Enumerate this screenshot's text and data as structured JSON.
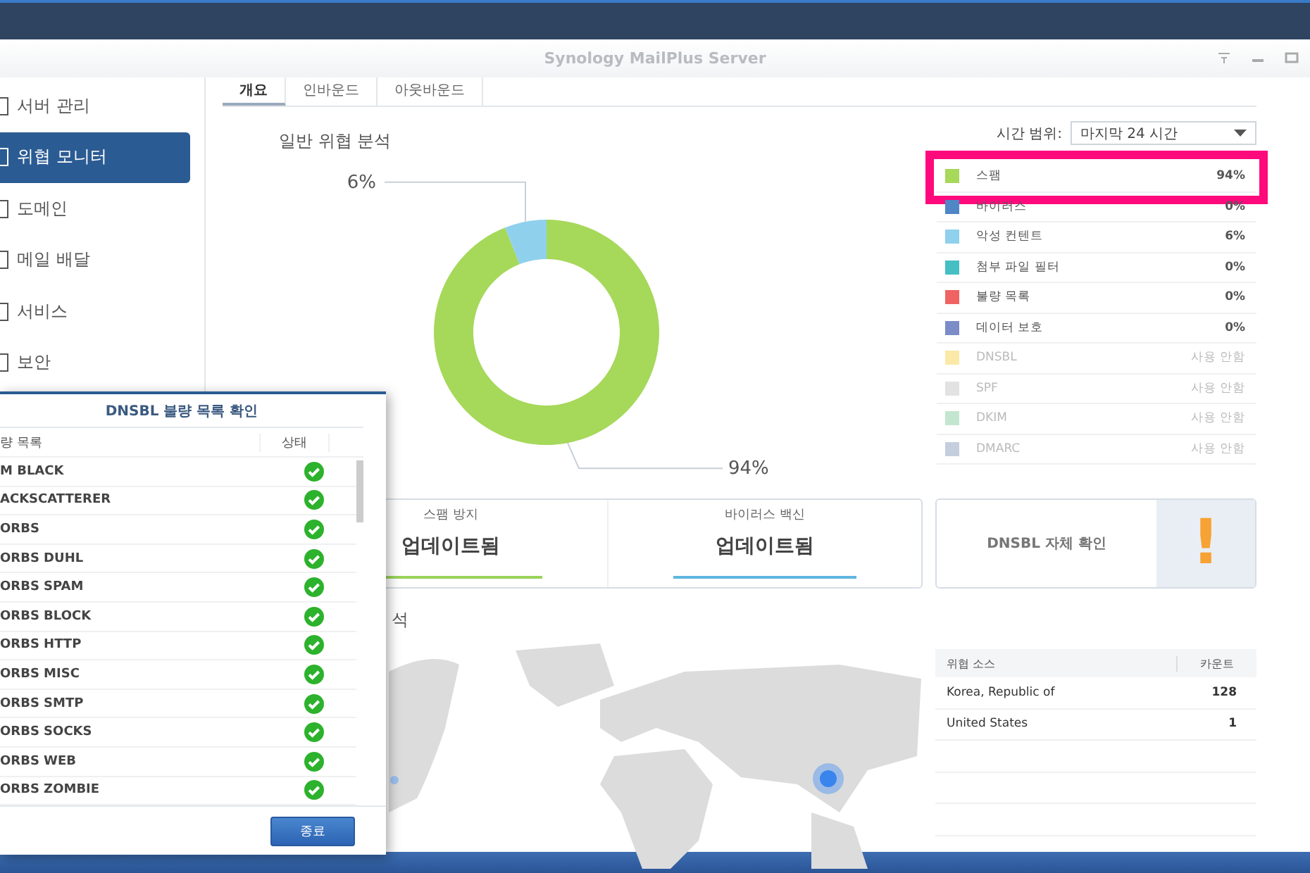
{
  "window": {
    "title": "Synology MailPlus Server"
  },
  "sidebar": {
    "items": [
      {
        "label": "서버 관리",
        "selected": false
      },
      {
        "label": "위협 모니터",
        "selected": true
      },
      {
        "label": "도메인",
        "selected": false
      },
      {
        "label": "메일 배달",
        "selected": false
      },
      {
        "label": "서비스",
        "selected": false
      },
      {
        "label": "보안",
        "selected": false
      }
    ]
  },
  "tabs": [
    {
      "label": "개요",
      "selected": true
    },
    {
      "label": "인바운드",
      "selected": false
    },
    {
      "label": "아웃바운드",
      "selected": false
    }
  ],
  "general_analysis": {
    "title": "일반 위협 분석",
    "time_range": {
      "label": "시간 범위:",
      "value": "마지막 24 시간"
    },
    "chart_data": {
      "type": "donut",
      "values": [
        94,
        6
      ],
      "colors": [
        "#a6d85a",
        "#8fd0ec"
      ],
      "value_labels": [
        "94%",
        "6%"
      ]
    },
    "legend": [
      {
        "label": "스팸",
        "value": "94%",
        "color": "#a6d85a",
        "enabled": true,
        "highlighted": true
      },
      {
        "label": "바이러스",
        "value": "0%",
        "color": "#4f86c6",
        "enabled": true,
        "highlighted": false
      },
      {
        "label": "악성 컨텐트",
        "value": "6%",
        "color": "#8fd0ec",
        "enabled": true,
        "highlighted": false
      },
      {
        "label": "첨부 파일 필터",
        "value": "0%",
        "color": "#45bfc3",
        "enabled": true,
        "highlighted": false
      },
      {
        "label": "불량 목록",
        "value": "0%",
        "color": "#ef6363",
        "enabled": true,
        "highlighted": false
      },
      {
        "label": "데이터 보호",
        "value": "0%",
        "color": "#7b8cc6",
        "enabled": true,
        "highlighted": false
      },
      {
        "label": "DNSBL",
        "value": "사용 안함",
        "color": "#fbe9a8",
        "enabled": false,
        "highlighted": false
      },
      {
        "label": "SPF",
        "value": "사용 안함",
        "color": "#e2e2e2",
        "enabled": false,
        "highlighted": false
      },
      {
        "label": "DKIM",
        "value": "사용 안함",
        "color": "#c3e6d0",
        "enabled": false,
        "highlighted": false
      },
      {
        "label": "DMARC",
        "value": "사용 안함",
        "color": "#c4cedd",
        "enabled": false,
        "highlighted": false
      }
    ]
  },
  "status_cards": [
    {
      "label": "스팸 방지",
      "value": "업데이트됨",
      "color": "#9bd35a"
    },
    {
      "label": "바이러스 백신",
      "value": "업데이트됨",
      "color": "#5fb6e0"
    }
  ],
  "dnsbl_check": {
    "label": "DNSBL 자체 확인",
    "icon": "!"
  },
  "threat_source": {
    "title": "석",
    "columns": [
      "위협 소스",
      "카운트"
    ],
    "rows": [
      {
        "source": "Korea, Republic of",
        "count": "128"
      },
      {
        "source": "United States",
        "count": "1"
      }
    ]
  },
  "dialog": {
    "title": "DNSBL 불량 목록 확인",
    "columns": [
      "량 목록",
      "상태"
    ],
    "rows": [
      {
        "name": "M BLACK",
        "ok": true
      },
      {
        "name": "ACKSCATTERER",
        "ok": true
      },
      {
        "name": "ORBS",
        "ok": true
      },
      {
        "name": "ORBS DUHL",
        "ok": true
      },
      {
        "name": "ORBS SPAM",
        "ok": true
      },
      {
        "name": "ORBS BLOCK",
        "ok": true
      },
      {
        "name": "ORBS HTTP",
        "ok": true
      },
      {
        "name": "ORBS MISC",
        "ok": true
      },
      {
        "name": "ORBS SMTP",
        "ok": true
      },
      {
        "name": "ORBS SOCKS",
        "ok": true
      },
      {
        "name": "ORBS WEB",
        "ok": true
      },
      {
        "name": "ORBS ZOMBIE",
        "ok": true
      }
    ],
    "button": "종료"
  }
}
